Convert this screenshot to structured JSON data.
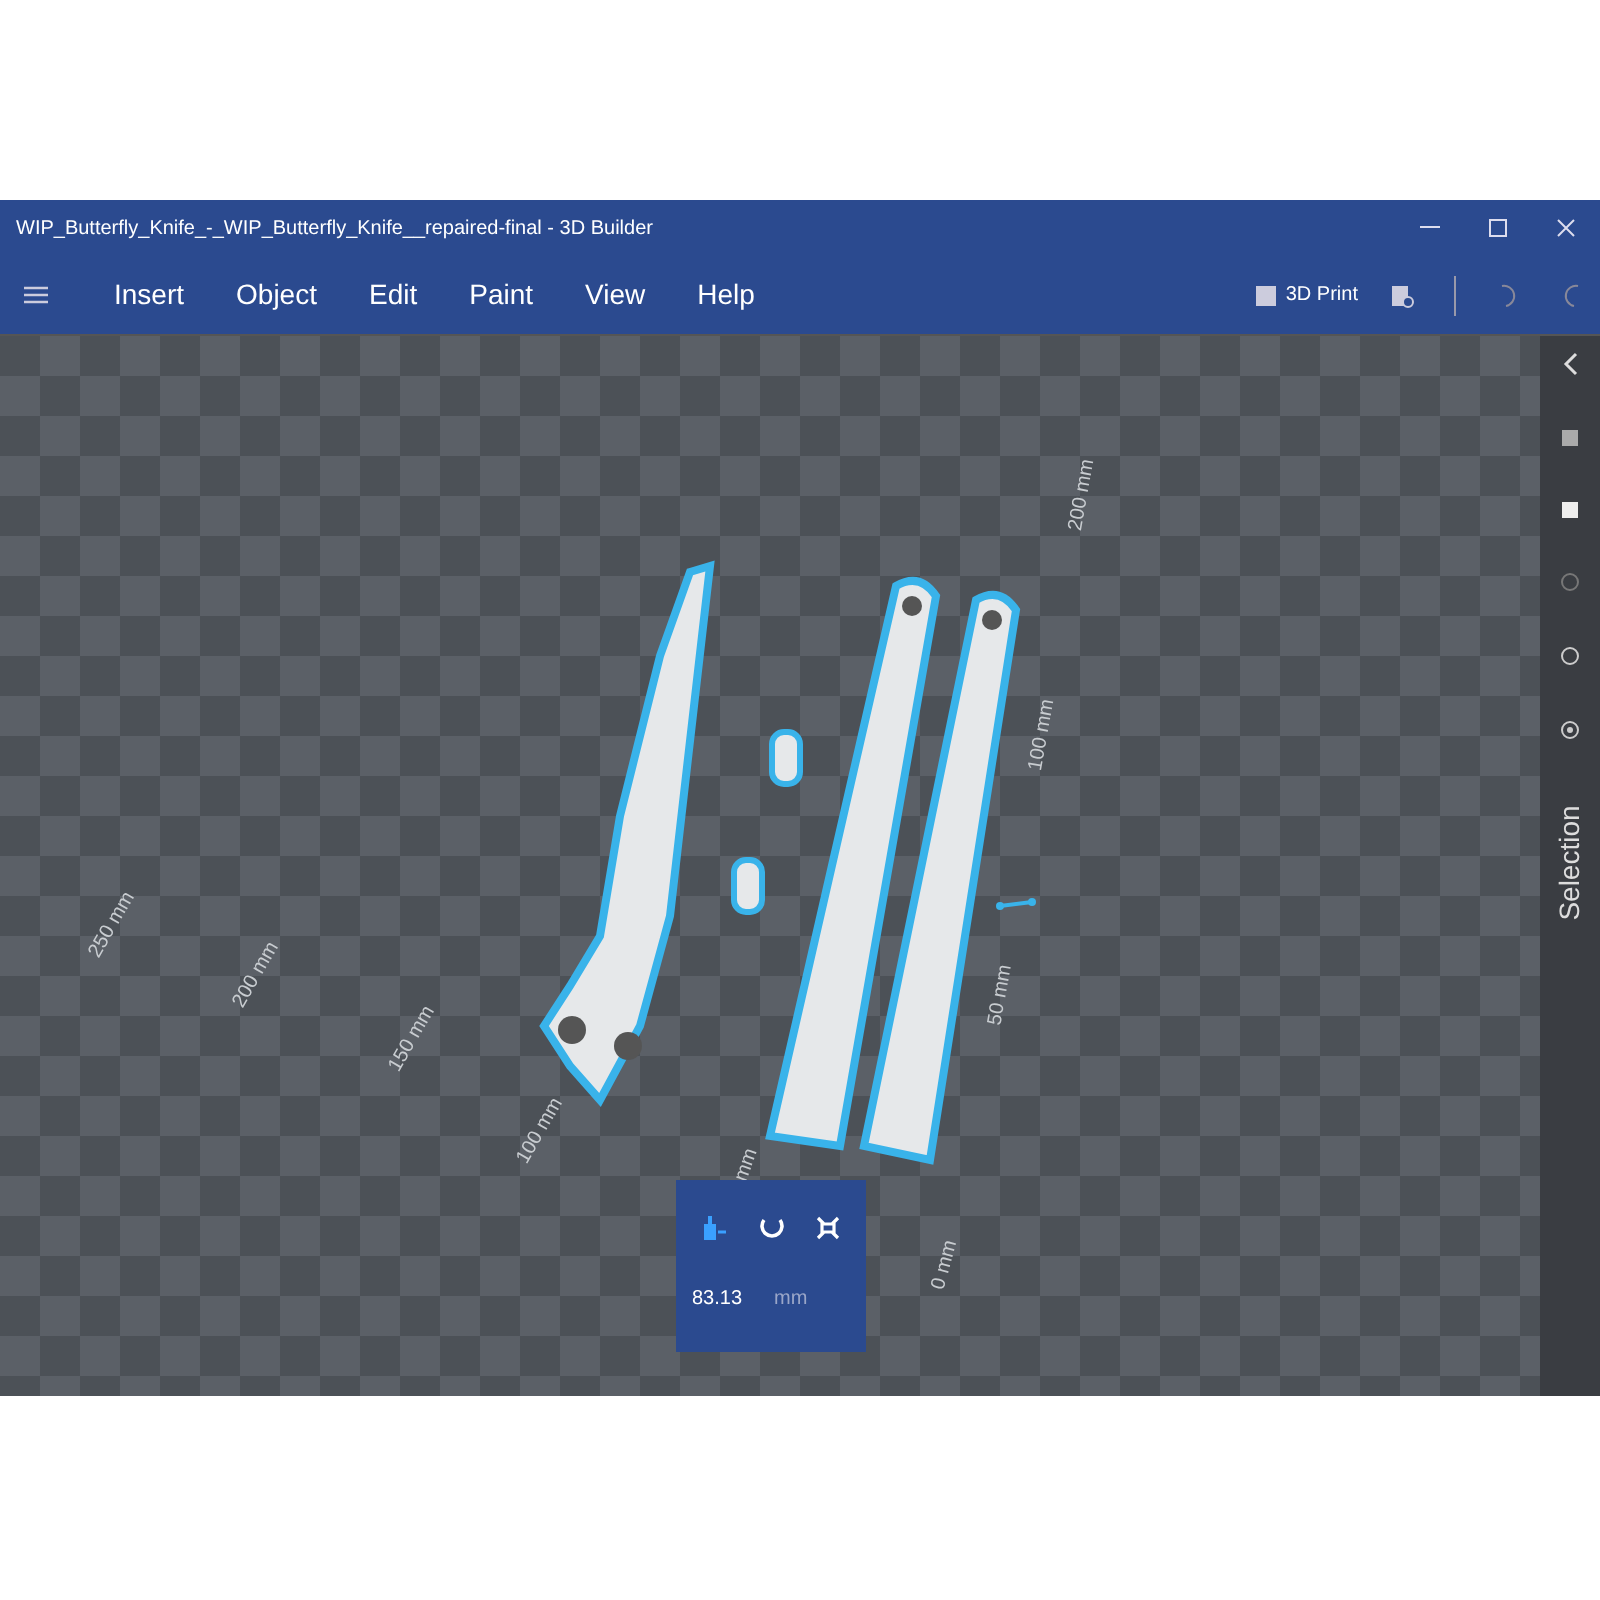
{
  "window": {
    "title": "WIP_Butterfly_Knife_-_WIP_Butterfly_Knife__repaired-final - 3D Builder"
  },
  "menu": [
    "Insert",
    "Object",
    "Edit",
    "Paint",
    "View",
    "Help"
  ],
  "toolbar": {
    "print_label": "3D Print"
  },
  "axis_labels": [
    "250 mm",
    "200 mm",
    "150 mm",
    "100 mm",
    "mm",
    "0 mm",
    "50 mm",
    "100 mm",
    "200 mm"
  ],
  "sidebar": {
    "label": "Selection"
  },
  "transform_panel": {
    "tools": [
      {
        "kind": "move",
        "selected": true
      },
      {
        "kind": "rotate",
        "selected": false
      },
      {
        "kind": "scale",
        "selected": false
      }
    ],
    "value": "83.13",
    "unit": "mm"
  }
}
